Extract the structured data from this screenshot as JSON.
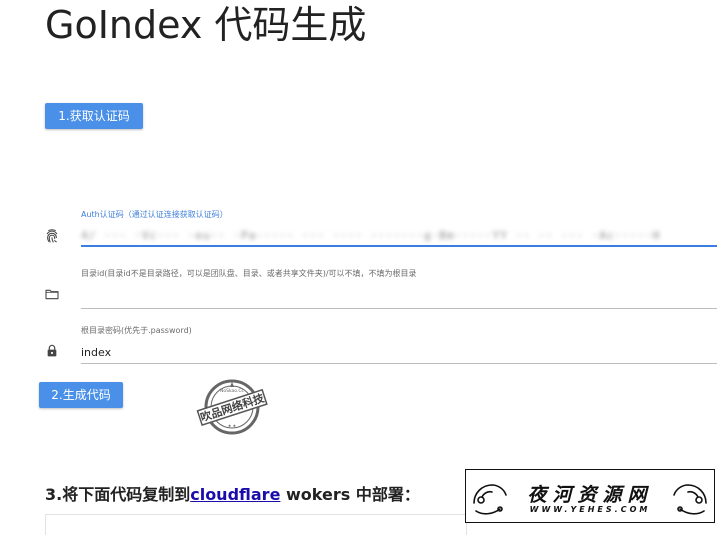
{
  "page": {
    "title": "GoIndex 代码生成"
  },
  "step1": {
    "button_label": "1.获取认证码"
  },
  "auth": {
    "label": "Auth认证码（通过认证连接获取认证码）",
    "value_obscured": "4/ ··· ·Vc··· ·eu·· ·Pa····· ··· ···· ·······g·Bm·····YY ·· ·· ··· ·Ac·····H"
  },
  "root": {
    "label": "目录id(目录id不是目录路径，可以是团队盘、目录、或者共享文件夹)/可以不填，不填为根目录",
    "value": ""
  },
  "password": {
    "label": "根目录密码(优先于.password)",
    "value": "index"
  },
  "step2": {
    "button_label": "2.生成代码"
  },
  "stamp": {
    "text": "吹品网络科技",
    "top_text": "NoSkao.Cc"
  },
  "step3": {
    "prefix": "3.将下面代码复制到",
    "link": "cloudflare",
    "suffix": " wokers 中部署："
  },
  "watermark": {
    "title": "夜河资源网",
    "url": "WWW.YEHES.COM"
  },
  "colors": {
    "primary": "#4a90e8",
    "focus_underline": "#3a7fe0",
    "link": "#1a0dab"
  },
  "icons": {
    "auth": "fingerprint-icon",
    "root": "folder-icon",
    "password": "lock-icon"
  }
}
